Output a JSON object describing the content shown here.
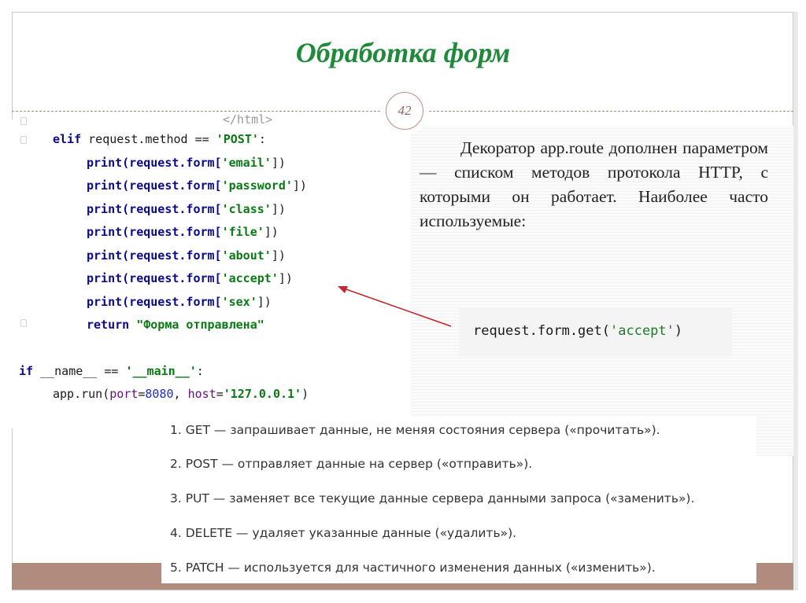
{
  "slide": {
    "title": "Обработка форм",
    "page_number": "42"
  },
  "code": {
    "line0": "</html>",
    "elif_kw": "elif",
    "elif_rest": " request.method == ",
    "elif_str": "'POST'",
    "elif_colon": ":",
    "print_lines": [
      {
        "pre": "print(request.form[",
        "key": "'email'",
        "post": "])"
      },
      {
        "pre": "print(request.form[",
        "key": "'password'",
        "post": "])"
      },
      {
        "pre": "print(request.form[",
        "key": "'class'",
        "post": "])"
      },
      {
        "pre": "print(request.form[",
        "key": "'file'",
        "post": "])"
      },
      {
        "pre": "print(request.form[",
        "key": "'about'",
        "post": "])"
      },
      {
        "pre": "print(request.form[",
        "key": "'accept'",
        "post": "])"
      },
      {
        "pre": "print(request.form[",
        "key": "'sex'",
        "post": "])"
      }
    ],
    "return_kw": "return",
    "return_str": "\"Форма отправлена\"",
    "if_kw": "if",
    "if_rest": " __name__ == ",
    "if_str": "'__main__'",
    "if_colon": ":",
    "run_pre": "app.run(",
    "run_port_kw": "port",
    "run_eq1": "=",
    "run_port": "8080",
    "run_comma": ", ",
    "run_host_kw": "host",
    "run_eq2": "=",
    "run_host": "'127.0.0.1'",
    "run_post": ")"
  },
  "description": "Декоратор app.route дополнен параметром — списком методов протокола HTTP, с которыми он работает. Наиболее часто используемые:",
  "snippet": {
    "pre": "request.form.get(",
    "key": "'accept'",
    "post": ")"
  },
  "methods": [
    "1. GET — запрашивает данные, не меняя состояния сервера («прочитать»).",
    "2. POST — отправляет данные на сервер («отправить»).",
    "3. PUT — заменяет все текущие данные сервера данными запроса («заменить»).",
    "4. DELETE — удаляет указанные данные («удалить»).",
    "5. PATCH — используется для частичного изменения данных («изменить»)."
  ],
  "colors": {
    "title": "#1f8a3a",
    "accent_band": "#b08b7e",
    "arrow": "#c0282d"
  }
}
